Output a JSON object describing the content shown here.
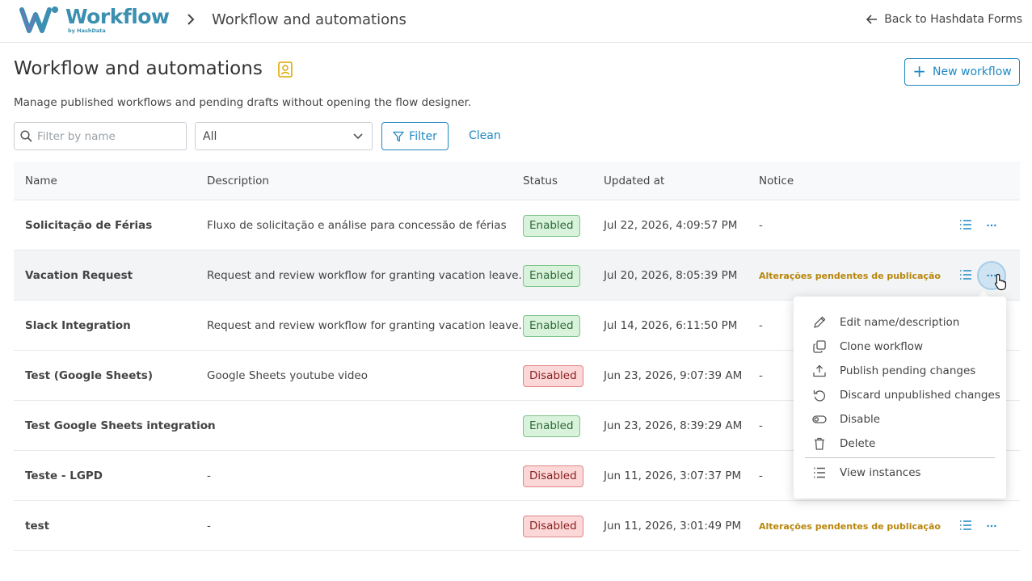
{
  "header": {
    "logo_text": "Workflow",
    "logo_sub": "by HashData",
    "breadcrumb_title": "Workflow and automations",
    "back_label": "Back to Hashdata Forms"
  },
  "page": {
    "title": "Workflow and automations",
    "subtitle": "Manage published workflows and pending drafts without opening the flow designer.",
    "new_button": "New workflow"
  },
  "filters": {
    "search_placeholder": "Filter by name",
    "select_value": "All",
    "filter_button": "Filter",
    "clean_link": "Clean"
  },
  "table": {
    "columns": [
      "Name",
      "Description",
      "Status",
      "Updated at",
      "Notice"
    ],
    "rows": [
      {
        "name": "Solicitação de Férias",
        "description": "Fluxo de solicitação e análise para concessão de férias",
        "status": "Enabled",
        "updated": "Jul 22, 2026, 4:09:57 PM",
        "notice": "-"
      },
      {
        "name": "Vacation Request",
        "description": "Request and review workflow for granting vacation leave.",
        "status": "Enabled",
        "updated": "Jul 20, 2026, 8:05:39 PM",
        "notice": "Alterações pendentes de publicação"
      },
      {
        "name": "Slack Integration",
        "description": "Request and review workflow for granting vacation leave.",
        "status": "Enabled",
        "updated": "Jul 14, 2026, 6:11:50 PM",
        "notice": "-"
      },
      {
        "name": "Test (Google Sheets)",
        "description": "Google Sheets youtube video",
        "status": "Disabled",
        "updated": "Jun 23, 2026, 9:07:39 AM",
        "notice": "-"
      },
      {
        "name": "Test Google Sheets integration",
        "description": "-",
        "status": "Enabled",
        "updated": "Jun 23, 2026, 8:39:29 AM",
        "notice": "-"
      },
      {
        "name": "Teste - LGPD",
        "description": "-",
        "status": "Disabled",
        "updated": "Jun 11, 2026, 3:07:37 PM",
        "notice": "-"
      },
      {
        "name": "test",
        "description": "-",
        "status": "Disabled",
        "updated": "Jun 11, 2026, 3:01:49 PM",
        "notice": "Alterações pendentes de publicação"
      }
    ]
  },
  "menu": {
    "items": [
      "Edit name/description",
      "Clone workflow",
      "Publish pending changes",
      "Discard unpublished changes",
      "Disable",
      "Delete",
      "View instances"
    ]
  },
  "colors": {
    "accent": "#1f88c4",
    "brand": "#3b8fb0",
    "enabled_bg": "#d9f2dc",
    "disabled_bg": "#fbd7d7",
    "notice": "#b8860b"
  }
}
